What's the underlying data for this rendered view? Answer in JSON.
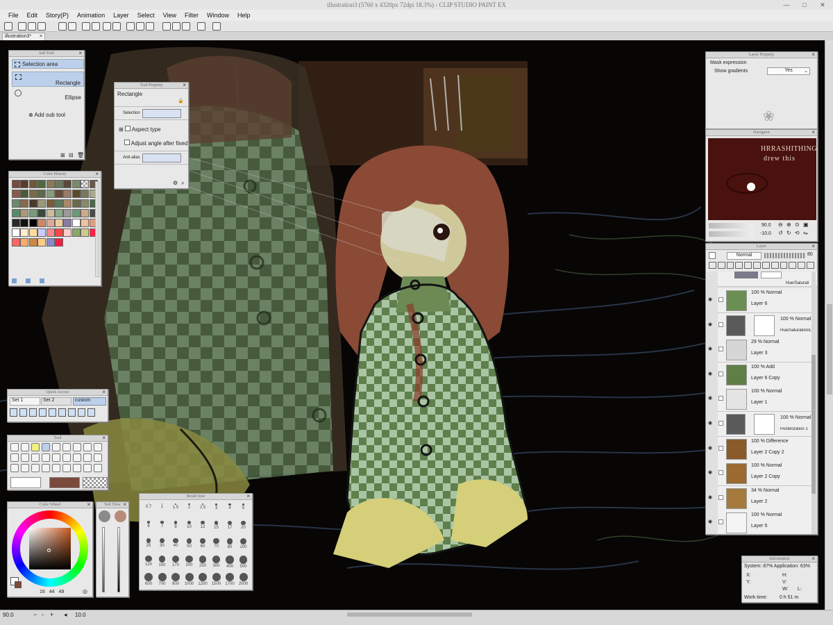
{
  "window": {
    "title": "illustration3 (5760 x 4320px 72dpi 18.3%) - CLIP STUDIO PAINT EX",
    "minimize": "—",
    "maximize": "□",
    "close": "✕"
  },
  "menu": [
    "File",
    "Edit",
    "Story(P)",
    "Animation",
    "Layer",
    "Select",
    "View",
    "Filter",
    "Window",
    "Help"
  ],
  "tab": {
    "label": "illustration3*",
    "close": "×"
  },
  "sub_tool": {
    "header": "Sub Tool",
    "group": "Selection area",
    "items": [
      {
        "label": "Rectangle",
        "selected": true
      },
      {
        "label": "Ellipse",
        "selected": false
      }
    ],
    "add": "Add sub tool"
  },
  "tool_property": {
    "header": "Tool Property",
    "tool_name": "Rectangle",
    "selection_label": "Selection",
    "aspect_label": "Aspect type",
    "adjust_label": "Adjust angle after fixed",
    "antialias_label": "Anti-alias"
  },
  "color_history": {
    "header": "Color History"
  },
  "quick_access": {
    "header": "Quick Access",
    "sets": [
      "Set 1",
      "Set 2",
      "custom"
    ]
  },
  "tool": {
    "header": "Tool"
  },
  "color_wheel": {
    "header": "Color Wheel",
    "values": [
      "16",
      "44",
      "49"
    ]
  },
  "sub_view": {
    "header": "Sub View"
  },
  "brush_size": {
    "header": "Brush Size",
    "sizes": [
      "0.7",
      "1",
      "1.5",
      "2",
      "2.5",
      "3",
      "4",
      "5",
      "6",
      "7",
      "8",
      "10",
      "12",
      "15",
      "17",
      "20",
      "25",
      "30",
      "40",
      "50",
      "60",
      "70",
      "80",
      "100",
      "120",
      "150",
      "170",
      "200",
      "250",
      "300",
      "400",
      "500",
      "600",
      "700",
      "800",
      "1000",
      "1200",
      "1500",
      "1700",
      "2000"
    ]
  },
  "layer_property": {
    "header": "Layer Property",
    "mask_label": "Mask expression",
    "gradient_label": "Show gradients",
    "gradient_value": "Yes"
  },
  "navigator": {
    "header": "Navigator",
    "preview_line1": "HRRASHITHING",
    "preview_line2": "drew this",
    "zoom": "90.0",
    "angle": "-10.0"
  },
  "layer": {
    "header": "Layer",
    "blend": "Normal",
    "opacity": "80",
    "top_partial": "Hue/Saturati",
    "rows": [
      {
        "mode": "100 % Normal",
        "name": "Layer 6",
        "kind": "thumb",
        "thumb_color": "#6b8f52"
      },
      {
        "mode": "100 % Normal",
        "name": "Hue/Saturation/Lu",
        "kind": "adjust"
      },
      {
        "mode": "29 % Normal",
        "name": "Layer 3",
        "kind": "thumb",
        "thumb_color": "#d6d6d6"
      },
      {
        "mode": "100 % Add",
        "name": "Layer 6 Copy",
        "kind": "thumb",
        "thumb_color": "#5f7f46"
      },
      {
        "mode": "100 % Normal",
        "name": "Layer 1",
        "kind": "thumb",
        "thumb_color": "#e4e4e4"
      },
      {
        "mode": "100 % Normal",
        "name": "Posterization 1",
        "kind": "adjust"
      },
      {
        "mode": "100 % Difference",
        "name": "Layer 2 Copy 2",
        "kind": "thumb",
        "thumb_color": "#8a5a2a"
      },
      {
        "mode": "100 % Normal",
        "name": "Layer 2 Copy",
        "kind": "thumb",
        "thumb_color": "#9a6a32"
      },
      {
        "mode": "34 % Normal",
        "name": "Layer 2",
        "kind": "thumb",
        "thumb_color": "#a57a3c"
      },
      {
        "mode": "100 % Normal",
        "name": "Layer 5",
        "kind": "thumb",
        "thumb_color": "#f4f4f4"
      }
    ]
  },
  "information": {
    "header": "Information",
    "system": "System: 87%  Application: 63%",
    "x": "X:",
    "y": "Y:",
    "h": "H:",
    "v": "V:",
    "w": "W:",
    "l": "L:",
    "time_label": "Work time:",
    "time_value": "0 h 51 m"
  },
  "status": {
    "zoom": "90.0",
    "angle": "10.0"
  },
  "colors": {
    "main": "#ffffff",
    "sub": "#7a4a3c",
    "hue_square": "#c85a1e",
    "selection_accent": "#bcd0ec"
  }
}
